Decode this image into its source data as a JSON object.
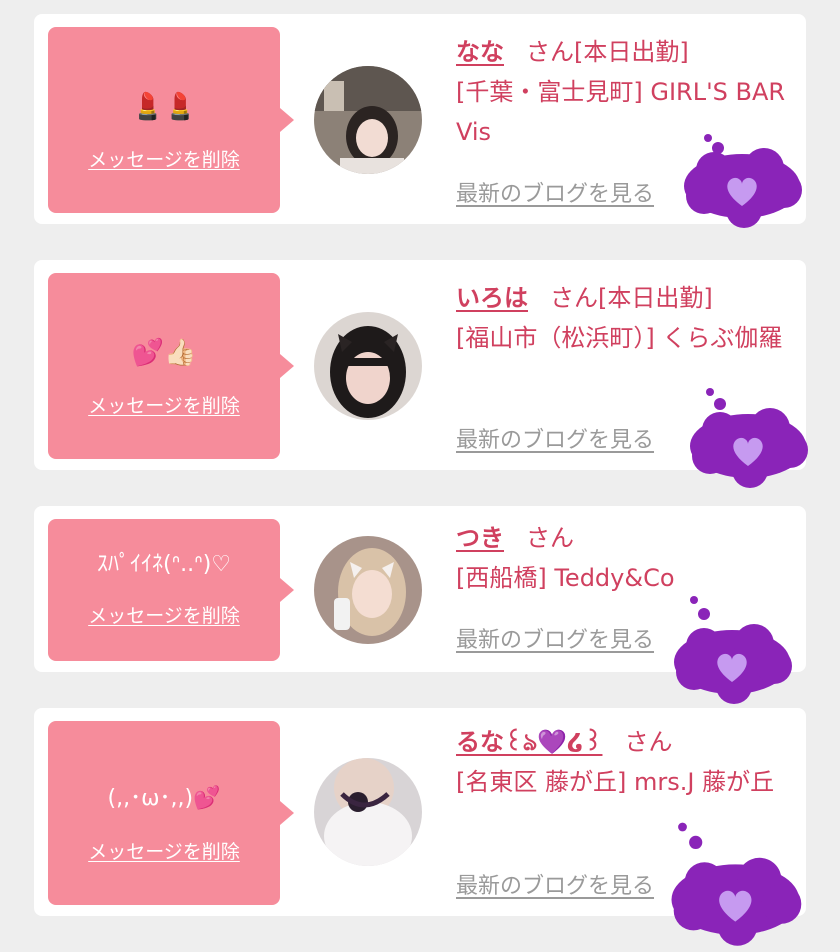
{
  "colors": {
    "page_background": "#eeeeee",
    "card_background": "#ffffff",
    "bubble_pink": "#f68c9b",
    "name_color": "#d0405f",
    "blog_link_color": "#9a9a9a",
    "cloud_purple": "#8a24b8"
  },
  "messages": [
    {
      "stamp": "💄💄",
      "delete_label": "メッセージを削除",
      "name": "なな",
      "honorific": "さん",
      "status": "[本日出勤]",
      "shop": "[千葉・富士見町] GIRL'S BAR Vis",
      "blog_label": "最新のブログを見る",
      "avatar_icon": "profile-photo-icon",
      "decoration_icon": "purple-heart-cloud-icon"
    },
    {
      "stamp": "💕👍🏻",
      "delete_label": "メッセージを削除",
      "name": "いろは",
      "honorific": "さん",
      "status": "[本日出勤]",
      "shop": "[福山市（松浜町）] くらぶ伽羅",
      "blog_label": "最新のブログを見る",
      "avatar_icon": "profile-photo-icon",
      "decoration_icon": "purple-heart-cloud-icon"
    },
    {
      "stamp": "ｽﾊﾟｲｲﾈ(ᐢ..ᐢ)♡",
      "delete_label": "メッセージを削除",
      "name": "つき",
      "honorific": "さん",
      "status": "",
      "shop": "[西船橋] Teddy&Co",
      "blog_label": "最新のブログを見る",
      "avatar_icon": "profile-photo-icon",
      "decoration_icon": "purple-heart-cloud-icon"
    },
    {
      "stamp": "(,,･ω･,,)💕",
      "delete_label": "メッセージを削除",
      "name": "るな꒰ঌ💜໒꒱",
      "honorific": "さん",
      "status": "",
      "shop": "[名東区 藤が丘] mrs.J 藤が丘",
      "blog_label": "最新のブログを見る",
      "avatar_icon": "profile-photo-icon",
      "decoration_icon": "purple-heart-cloud-icon"
    }
  ]
}
